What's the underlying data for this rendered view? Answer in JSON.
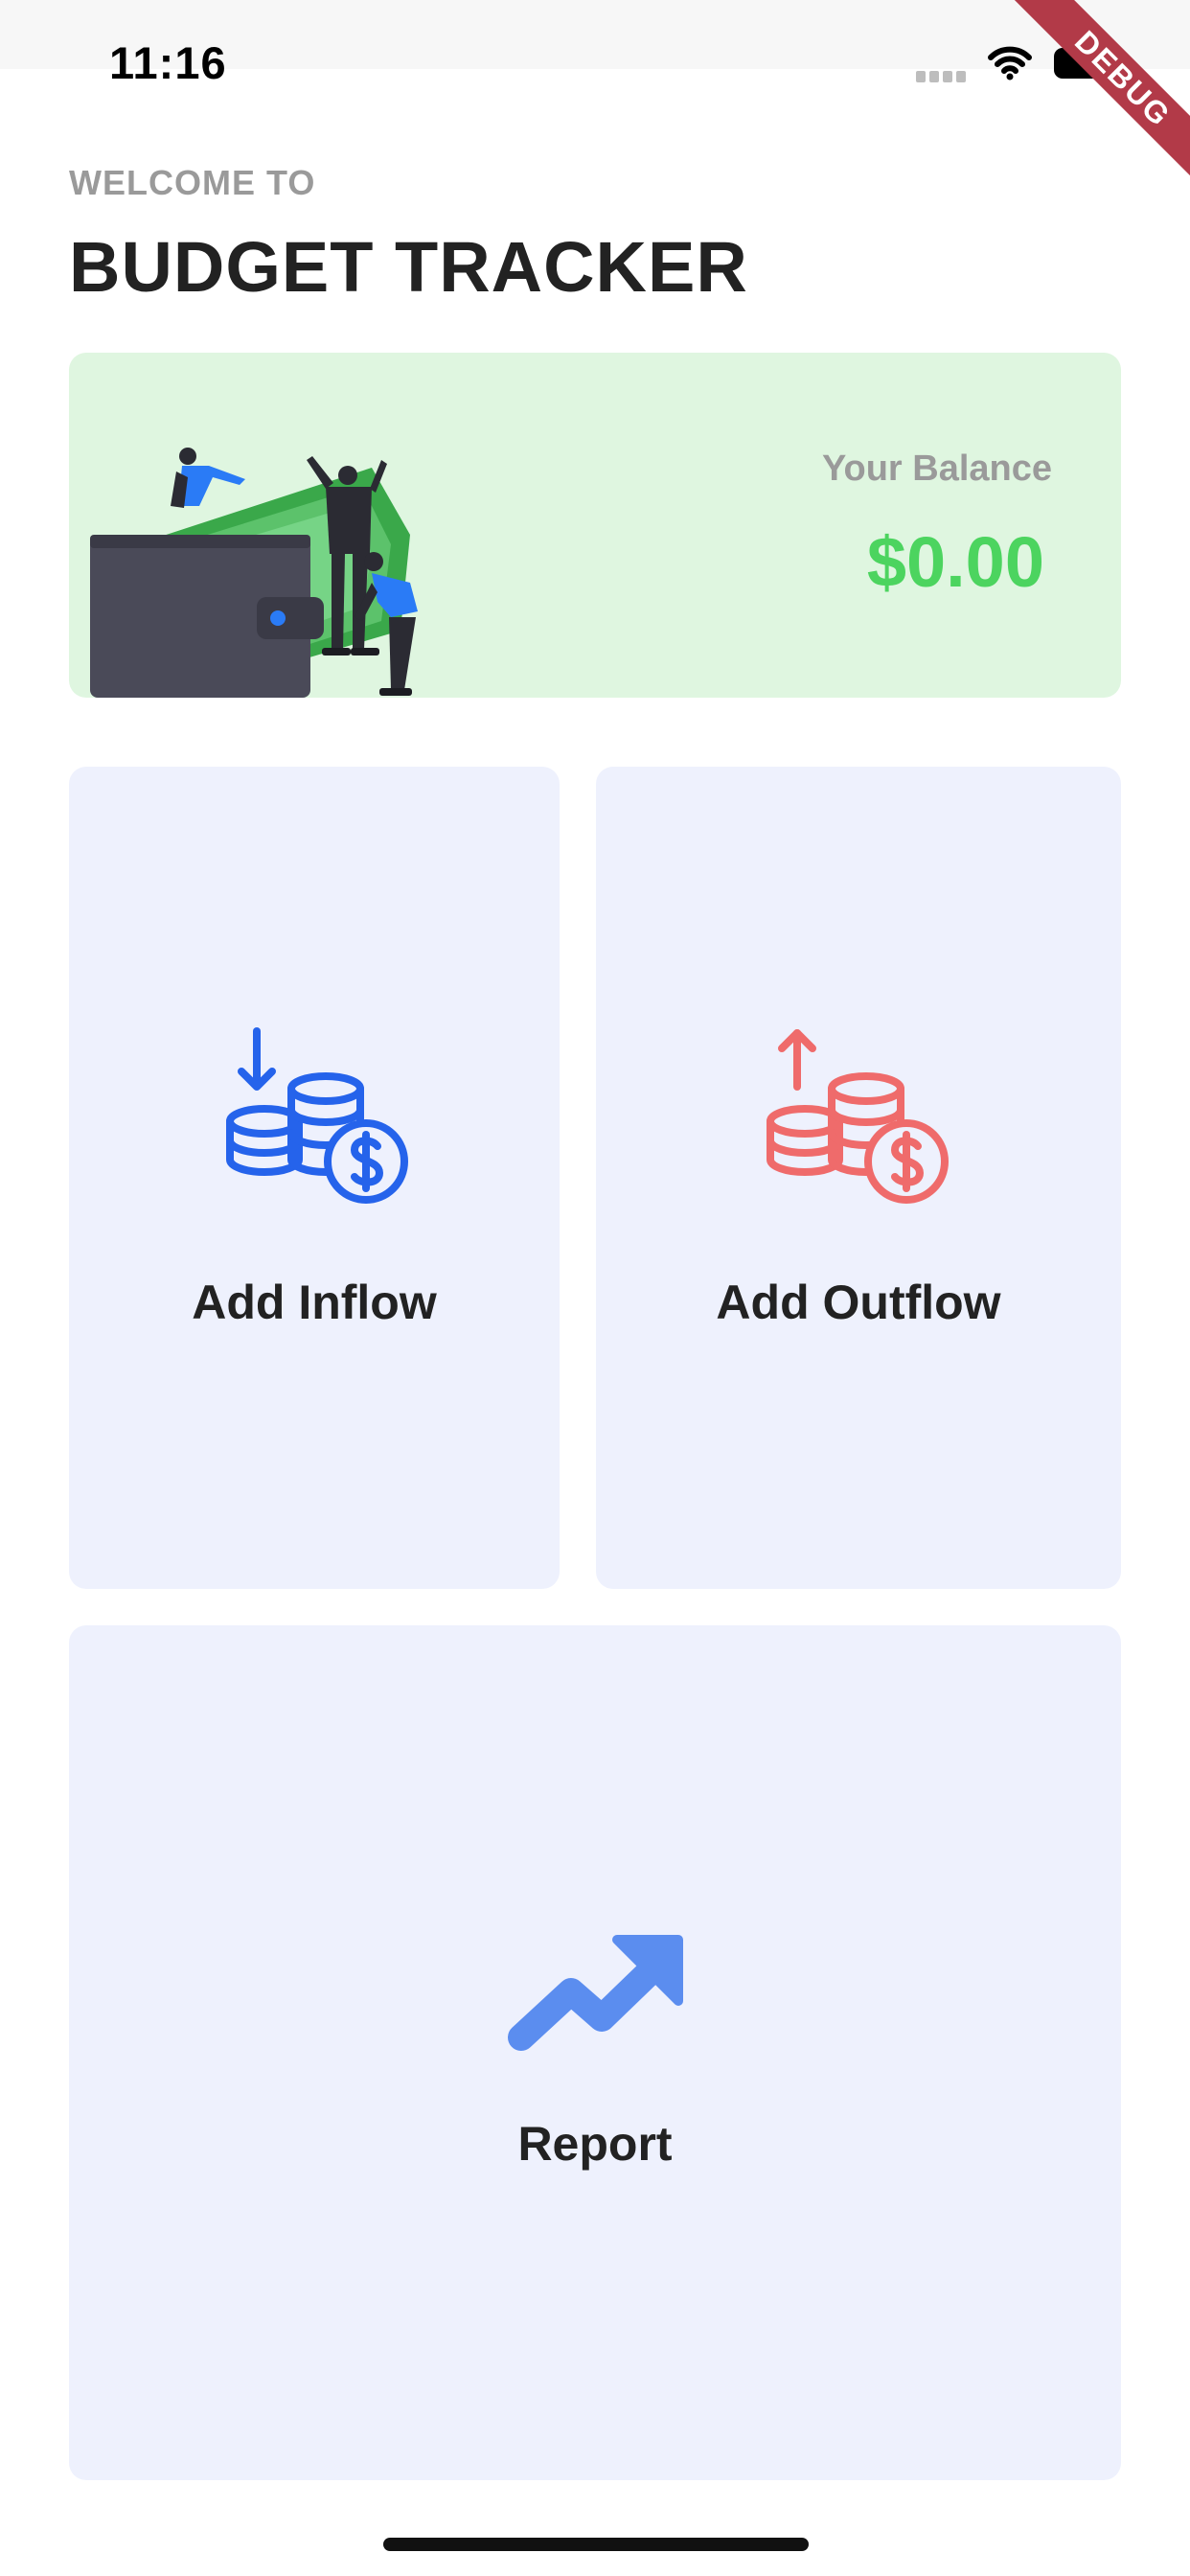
{
  "status_bar": {
    "time": "11:16",
    "icons": [
      "signal-icon",
      "wifi-icon",
      "battery-icon"
    ]
  },
  "debug_banner": "DEBUG",
  "header": {
    "welcome": "WELCOME TO",
    "title": "BUDGET TRACKER"
  },
  "balance": {
    "label": "Your Balance",
    "amount": "$0.00",
    "illustration": "wallet-money-illustration"
  },
  "actions": {
    "inflow": {
      "label": "Add Inflow",
      "icon": "coins-inflow-icon",
      "color": "#2563eb"
    },
    "outflow": {
      "label": "Add Outflow",
      "icon": "coins-outflow-icon",
      "color": "#ef6b6b"
    },
    "report": {
      "label": "Report",
      "icon": "trending-up-icon",
      "color": "#5b8def"
    }
  },
  "colors": {
    "balance_bg": "#dff6e0",
    "balance_amount": "#4cd45f",
    "tile_bg": "#eef1fd"
  }
}
